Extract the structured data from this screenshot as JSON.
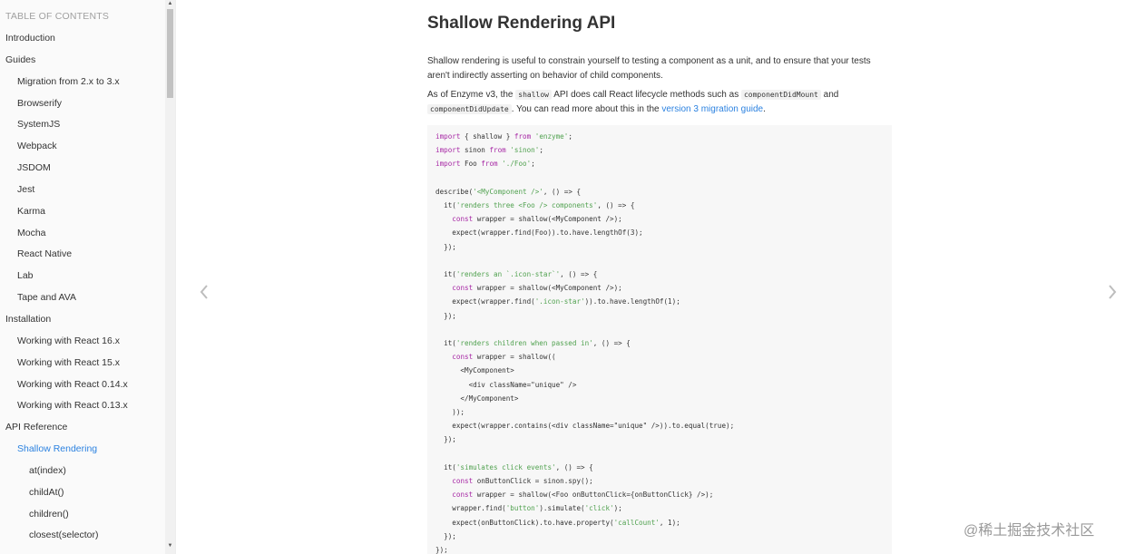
{
  "sidebar": {
    "title": "TABLE OF CONTENTS",
    "items": [
      {
        "label": "Introduction",
        "level": 0
      },
      {
        "label": "Guides",
        "level": 0
      },
      {
        "label": "Migration from 2.x to 3.x",
        "level": 1
      },
      {
        "label": "Browserify",
        "level": 1
      },
      {
        "label": "SystemJS",
        "level": 1
      },
      {
        "label": "Webpack",
        "level": 1
      },
      {
        "label": "JSDOM",
        "level": 1
      },
      {
        "label": "Jest",
        "level": 1
      },
      {
        "label": "Karma",
        "level": 1
      },
      {
        "label": "Mocha",
        "level": 1
      },
      {
        "label": "React Native",
        "level": 1
      },
      {
        "label": "Lab",
        "level": 1
      },
      {
        "label": "Tape and AVA",
        "level": 1
      },
      {
        "label": "Installation",
        "level": 0
      },
      {
        "label": "Working with React 16.x",
        "level": 1
      },
      {
        "label": "Working with React 15.x",
        "level": 1
      },
      {
        "label": "Working with React 0.14.x",
        "level": 1
      },
      {
        "label": "Working with React 0.13.x",
        "level": 1
      },
      {
        "label": "API Reference",
        "level": 0
      },
      {
        "label": "Shallow Rendering",
        "level": 1,
        "active": true
      },
      {
        "label": "at(index)",
        "level": 2
      },
      {
        "label": "childAt()",
        "level": 2
      },
      {
        "label": "children()",
        "level": 2
      },
      {
        "label": "closest(selector)",
        "level": 2
      }
    ]
  },
  "main": {
    "title": "Shallow Rendering API",
    "intro": "Shallow rendering is useful to constrain yourself to testing a component as a unit, and to ensure that your tests aren't indirectly asserting on behavior of child components.",
    "p2": {
      "t1": "As of Enzyme v3, the ",
      "c1": "shallow",
      "t2": " API does call React lifecycle methods such as ",
      "c2": "componentDidMount",
      "t3": " and ",
      "c3": "componentDidUpdate",
      "t4": ". You can read more about this in the ",
      "link": "version 3 migration guide",
      "t5": "."
    },
    "code_lines": [
      "import { shallow } from 'enzyme';",
      "import sinon from 'sinon';",
      "import Foo from './Foo';",
      "",
      "describe('<MyComponent />', () => {",
      "  it('renders three <Foo /> components', () => {",
      "    const wrapper = shallow(<MyComponent />);",
      "    expect(wrapper.find(Foo)).to.have.lengthOf(3);",
      "  });",
      "",
      "  it('renders an `.icon-star`', () => {",
      "    const wrapper = shallow(<MyComponent />);",
      "    expect(wrapper.find('.icon-star')).to.have.lengthOf(1);",
      "  });",
      "",
      "  it('renders children when passed in', () => {",
      "    const wrapper = shallow((",
      "      <MyComponent>",
      "        <div className=\"unique\" />",
      "      </MyComponent>",
      "    ));",
      "    expect(wrapper.contains(<div className=\"unique\" />)).to.equal(true);",
      "  });",
      "",
      "  it('simulates click events', () => {",
      "    const onButtonClick = sinon.spy();",
      "    const wrapper = shallow(<Foo onButtonClick={onButtonClick} />);",
      "    wrapper.find('button').simulate('click');",
      "    expect(onButtonClick).to.have.property('callCount', 1);",
      "  });",
      "});"
    ]
  },
  "nav": {
    "prev_icon": "chevron-left-icon",
    "next_icon": "chevron-right-icon"
  },
  "watermark": "@稀土掘金技术社区",
  "colors": {
    "link": "#2c82e0",
    "code_bg": "#f7f7f7",
    "sidebar_bg": "#fafafa"
  }
}
